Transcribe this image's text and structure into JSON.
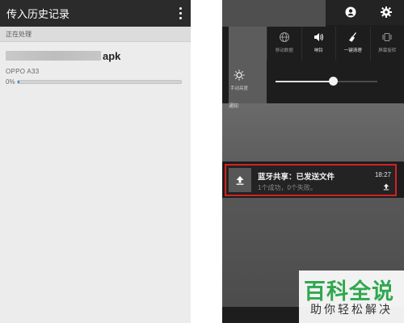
{
  "left": {
    "title": "传入历史记录",
    "section": "正在处理",
    "item": {
      "file_ext": "apk",
      "device": "OPPO A33",
      "percent_label": "0%",
      "progress": 0.01
    }
  },
  "right": {
    "quick_settings": [
      {
        "label": "移动数据",
        "icon": "globe-icon",
        "on": false
      },
      {
        "label": "响铃",
        "icon": "speaker-icon",
        "on": true
      },
      {
        "label": "一键清理",
        "icon": "broom-icon",
        "on": true
      },
      {
        "label": "屏幕旋转",
        "icon": "rotate-icon",
        "on": false
      }
    ],
    "brightness_label": "手动亮度",
    "brightness_level": 0.56,
    "notifications_header": "通知",
    "notification": {
      "title": "蓝牙共享：已发送文件",
      "subtitle": "1个成功，0个失败。",
      "time": "18:27"
    }
  },
  "watermark": {
    "main": "百科全说",
    "sub": "助你轻松解决"
  },
  "colors": {
    "highlight_border": "#d32222",
    "progress": "#3b8fd6",
    "watermark_green": "#2fa84f"
  }
}
